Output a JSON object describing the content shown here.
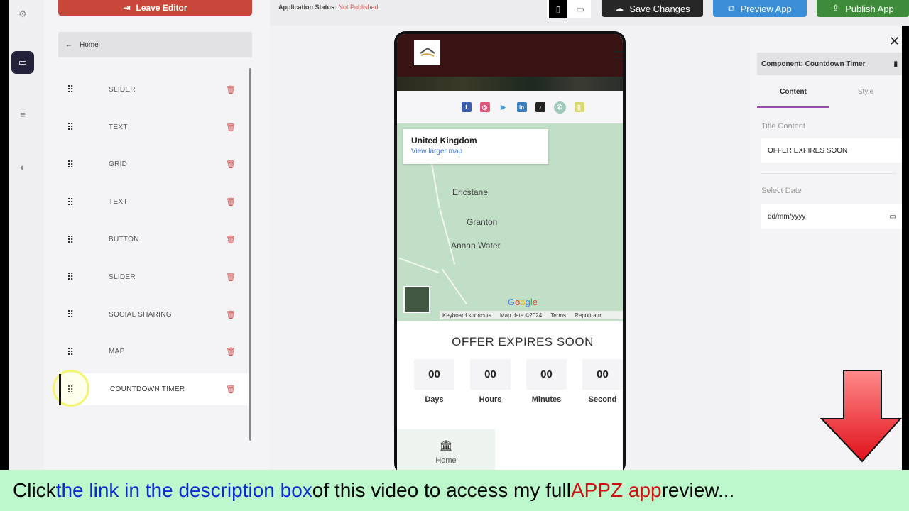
{
  "rail": {
    "items": [
      {
        "icon": "gear-icon",
        "glyph": "⚙"
      },
      {
        "icon": "page-icon",
        "glyph": "▭",
        "active": true
      },
      {
        "icon": "list-icon",
        "glyph": "≡"
      },
      {
        "icon": "palette-icon",
        "glyph": "◐"
      }
    ]
  },
  "left_panel": {
    "leave_editor": "Leave Editor",
    "home": "Home",
    "components": [
      {
        "label": "SLIDER"
      },
      {
        "label": "TEXT"
      },
      {
        "label": "GRID"
      },
      {
        "label": "TEXT"
      },
      {
        "label": "BUTTON"
      },
      {
        "label": "SLIDER"
      },
      {
        "label": "SOCIAL SHARING"
      },
      {
        "label": "MAP"
      },
      {
        "label": "COUNTDOWN TIMER",
        "selected": true
      }
    ]
  },
  "topbar": {
    "status_label": "Application Status:",
    "status_value": "Not Published",
    "status_color": "#e05555",
    "device_mobile": "▯",
    "device_desktop": "▭",
    "save": "Save Changes",
    "preview": "Preview App",
    "publish": "Publish App"
  },
  "phone": {
    "social_icons": [
      {
        "name": "facebook",
        "glyph": "f",
        "color": "#3b5dab"
      },
      {
        "name": "instagram",
        "glyph": "◎",
        "color": "#e0567a"
      },
      {
        "name": "twitter",
        "glyph": "🐦",
        "color": "#3ea0e6"
      },
      {
        "name": "linkedin",
        "glyph": "in",
        "color": "#3a7fbe"
      },
      {
        "name": "tiktok",
        "glyph": "♪",
        "color": "#222222"
      },
      {
        "name": "whatsapp",
        "glyph": "✆",
        "color": "#9fc9b8"
      },
      {
        "name": "snapchat",
        "glyph": "▯",
        "color": "#d8d870"
      }
    ],
    "map": {
      "card_title": "United Kingdom",
      "card_link": "View larger map",
      "places": [
        "Ericstane",
        "Granton",
        "Annan Water"
      ],
      "google": "Google",
      "footer": [
        "Keyboard shortcuts",
        "Map data ©2024",
        "Terms",
        "Report a m"
      ]
    },
    "timer": {
      "title": "OFFER EXPIRES SOON",
      "cells": [
        {
          "value": "00",
          "label": "Days"
        },
        {
          "value": "00",
          "label": "Hours"
        },
        {
          "value": "00",
          "label": "Minutes"
        },
        {
          "value": "00",
          "label": "Second"
        }
      ]
    },
    "nav_home": "Home"
  },
  "right_panel": {
    "close": "✕",
    "component_title": "Component: Countdown Timer",
    "tabs": [
      "Content",
      "Style"
    ],
    "title_label": "Title Content",
    "title_value": "OFFER EXPIRES SOON",
    "date_label": "Select Date",
    "date_placeholder": "dd/mm/yyyy"
  },
  "banner": {
    "part1": "Click ",
    "part2": "the link in the description box",
    "part3": " of this video to access my full ",
    "part4": "APPZ app",
    "part5": " review..."
  }
}
